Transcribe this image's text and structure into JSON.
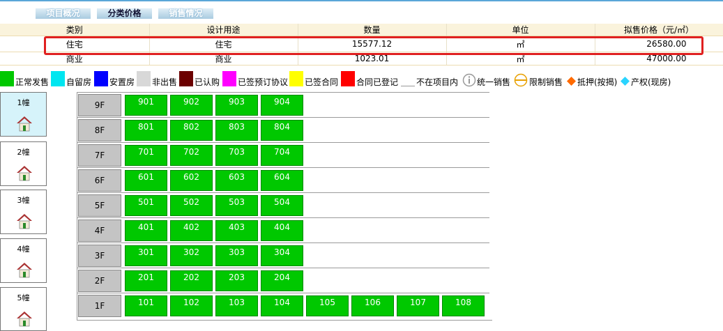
{
  "tabs": [
    {
      "label": "项目概况",
      "active": false
    },
    {
      "label": "分类价格",
      "active": true
    },
    {
      "label": "销售情况",
      "active": false
    }
  ],
  "price_table": {
    "headers": [
      "类别",
      "设计用途",
      "数量",
      "单位",
      "拟售价格（元/㎡）"
    ],
    "rows": [
      [
        "住宅",
        "住宅",
        "15577.12",
        "㎡",
        "26580.00"
      ],
      [
        "商业",
        "商业",
        "1023.01",
        "㎡",
        "47000.00"
      ]
    ]
  },
  "legend": [
    {
      "label": "正常发售",
      "color": "#00c800",
      "icon": "swatch"
    },
    {
      "label": "自留房",
      "color": "#00e6f0",
      "icon": "swatch"
    },
    {
      "label": "安置房",
      "color": "#0000ff",
      "icon": "swatch"
    },
    {
      "label": "非出售",
      "color": "#d8d8d8",
      "icon": "swatch"
    },
    {
      "label": "已认购",
      "color": "#6b0000",
      "icon": "swatch"
    },
    {
      "label": "已签预订协议",
      "color": "#ff00ff",
      "icon": "swatch"
    },
    {
      "label": "已签合同",
      "color": "#ffff00",
      "icon": "swatch"
    },
    {
      "label": "合同已登记",
      "color": "#ff0000",
      "icon": "swatch"
    },
    {
      "label": "不在项目内",
      "color": "#ffffff",
      "icon": "swatch"
    },
    {
      "label": "统一销售",
      "color": "#999999",
      "icon": "info-icon"
    },
    {
      "label": "限制销售",
      "color": "#e8a000",
      "icon": "restricted-icon"
    },
    {
      "label": "抵押(按揭)",
      "color": "#ff6a00",
      "icon": "diamond-icon"
    },
    {
      "label": "产权(现房)",
      "color": "#2ad4ff",
      "icon": "diamond-icon"
    }
  ],
  "buildings": [
    {
      "label": "1幢",
      "active": true
    },
    {
      "label": "2幢",
      "active": false
    },
    {
      "label": "3幢",
      "active": false
    },
    {
      "label": "4幢",
      "active": false
    },
    {
      "label": "5幢",
      "active": false
    }
  ],
  "floors": [
    {
      "label": "9F",
      "units": [
        "901",
        "902",
        "903",
        "904"
      ]
    },
    {
      "label": "8F",
      "units": [
        "801",
        "802",
        "803",
        "804"
      ]
    },
    {
      "label": "7F",
      "units": [
        "701",
        "702",
        "703",
        "704"
      ]
    },
    {
      "label": "6F",
      "units": [
        "601",
        "602",
        "603",
        "604"
      ]
    },
    {
      "label": "5F",
      "units": [
        "501",
        "502",
        "503",
        "504"
      ]
    },
    {
      "label": "4F",
      "units": [
        "401",
        "402",
        "403",
        "404"
      ]
    },
    {
      "label": "3F",
      "units": [
        "301",
        "302",
        "303",
        "304"
      ]
    },
    {
      "label": "2F",
      "units": [
        "201",
        "202",
        "203",
        "204"
      ]
    },
    {
      "label": "1F",
      "units": [
        "101",
        "102",
        "103",
        "104",
        "105",
        "106",
        "107",
        "108"
      ]
    }
  ]
}
